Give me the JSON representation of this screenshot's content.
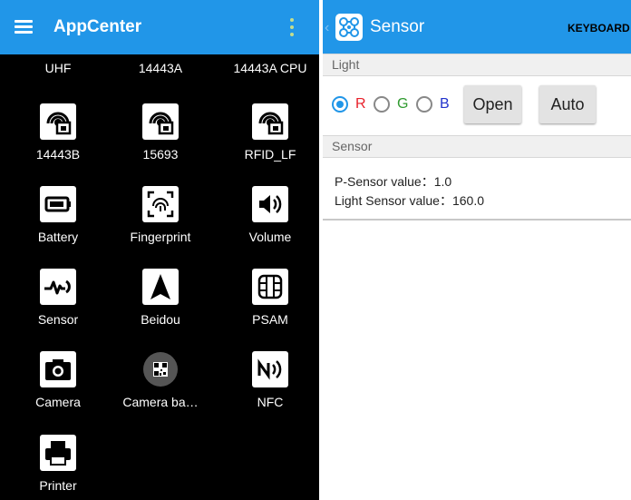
{
  "left_panel": {
    "title": "AppCenter",
    "icons": {
      "menu": "hamburger-icon",
      "overflow": "overflow-menu-icon"
    },
    "apps": [
      {
        "label": "UHF",
        "icon": "chip-icon"
      },
      {
        "label": "14443A",
        "icon": "chip-icon"
      },
      {
        "label": "14443A CPU",
        "icon": "chip-icon"
      },
      {
        "label": "14443B",
        "icon": "nfc-card-icon"
      },
      {
        "label": "15693",
        "icon": "nfc-card-icon"
      },
      {
        "label": "RFID_LF",
        "icon": "nfc-card-icon"
      },
      {
        "label": "Battery",
        "icon": "battery-icon"
      },
      {
        "label": "Fingerprint",
        "icon": "fingerprint-icon"
      },
      {
        "label": "Volume",
        "icon": "volume-icon"
      },
      {
        "label": "Sensor",
        "icon": "pulse-icon"
      },
      {
        "label": "Beidou",
        "icon": "navigation-arrow-icon"
      },
      {
        "label": "PSAM",
        "icon": "sim-card-icon"
      },
      {
        "label": "Camera",
        "icon": "camera-icon"
      },
      {
        "label": "Camera ba…",
        "icon": "qr-code-icon"
      },
      {
        "label": "NFC",
        "icon": "nfc-icon"
      },
      {
        "label": "Printer",
        "icon": "printer-icon"
      }
    ]
  },
  "right_panel": {
    "title": "Sensor",
    "keyboard_label": "KEYBOARD",
    "light_section": {
      "header": "Light",
      "radios": [
        {
          "label": "R",
          "checked": true,
          "color": "#e8202a"
        },
        {
          "label": "G",
          "checked": false,
          "color": "#2f9a2f"
        },
        {
          "label": "B",
          "checked": false,
          "color": "#2233cc"
        }
      ],
      "open_label": "Open",
      "auto_label": "Auto"
    },
    "sensor_section": {
      "header": "Sensor",
      "p_sensor": "P-Sensor value：1.0",
      "light_sensor": "Light Sensor value：160.0"
    }
  },
  "colors": {
    "accent": "#2196e8",
    "background_left": "#000000",
    "background_right": "#ffffff"
  }
}
